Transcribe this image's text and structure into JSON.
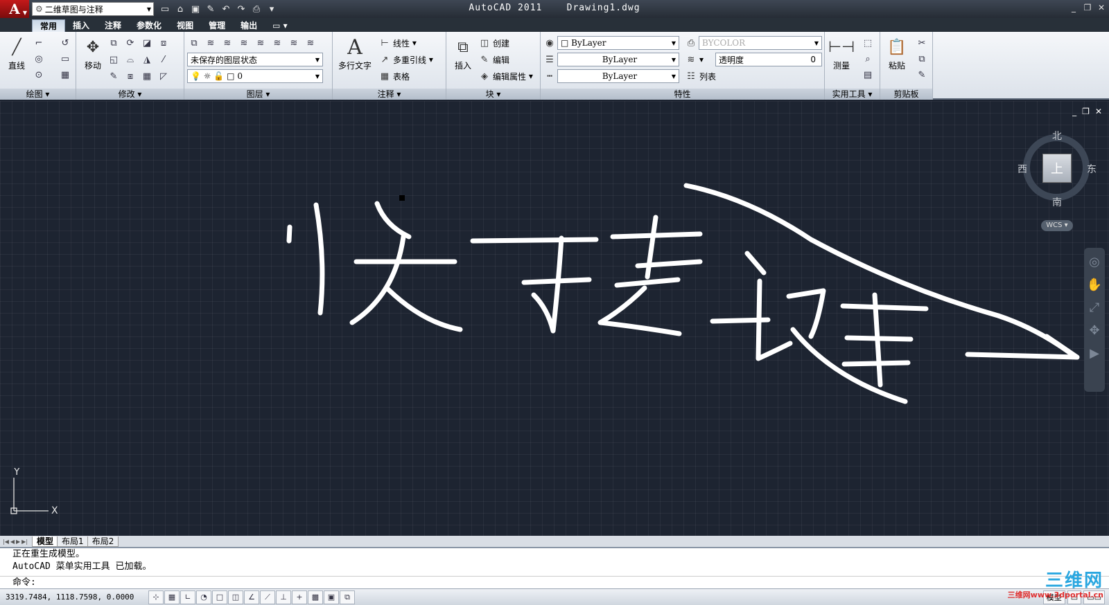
{
  "titlebar": {
    "workspace": "二维草图与注释",
    "title": "AutoCAD 2011",
    "document": "Drawing1.dwg"
  },
  "tabs": [
    "常用",
    "插入",
    "注释",
    "参数化",
    "视图",
    "管理",
    "输出"
  ],
  "ribbon": {
    "draw": {
      "label": "绘图",
      "line": "直线"
    },
    "modify": {
      "label": "修改",
      "move": "移动"
    },
    "layers": {
      "label": "图层",
      "state": "未保存的图层状态",
      "current": "0"
    },
    "annotation": {
      "label": "注释",
      "mtext": "多行文字",
      "linear": "线性",
      "mleader": "多重引线",
      "table": "表格"
    },
    "block": {
      "label": "块",
      "insert": "插入",
      "create": "创建",
      "edit": "编辑",
      "editattr": "编辑属性"
    },
    "properties": {
      "label": "特性",
      "color": "ByLayer",
      "linetype": "ByLayer",
      "lineweight": "ByLayer",
      "plotstyle": "BYCOLOR",
      "transparency": "透明度",
      "transparency_value": "0",
      "list": "列表"
    },
    "utilities": {
      "label": "实用工具",
      "measure": "测量"
    },
    "clipboard": {
      "label": "剪贴板",
      "paste": "粘贴"
    }
  },
  "viewcube": {
    "north": "北",
    "south": "南",
    "east": "东",
    "west": "西",
    "face": "上",
    "wcs": "WCS"
  },
  "ucs": {
    "x": "X",
    "y": "Y"
  },
  "layout_tabs": [
    "模型",
    "布局1",
    "布局2"
  ],
  "command": {
    "history": [
      "正在重生成模型。",
      "AutoCAD 菜单实用工具 已加载。"
    ],
    "prompt": "命令:"
  },
  "status": {
    "coords": "3319.7484, 1118.7598, 0.0000",
    "model": "模型"
  },
  "watermark": {
    "name": "三维网",
    "url": "三维网www.3dportal.cn"
  }
}
